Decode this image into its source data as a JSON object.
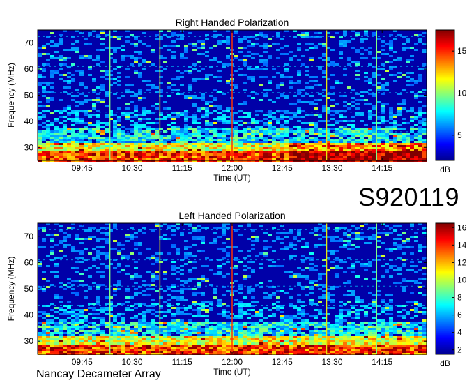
{
  "observation_id": "S920119",
  "instrument": "Nancay Decameter Array",
  "colors": {
    "jet_low": "#00008f",
    "jet_high": "#800000",
    "marker_yellow": "#e6e60a",
    "marker_green": "#7fff7f",
    "marker_red": "#ff3300"
  },
  "chart_data": [
    {
      "type": "heatmap",
      "title": "Right Handed Polarization",
      "xlabel": "Time (UT)",
      "ylabel": "Frequency (MHz)",
      "xticks": [
        "09:45",
        "10:30",
        "11:15",
        "12:00",
        "12:45",
        "13:30",
        "14:15"
      ],
      "xlim": [
        "09:05",
        "14:55"
      ],
      "yticks": [
        30,
        40,
        50,
        60,
        70
      ],
      "ylim": [
        25,
        75
      ],
      "colorbar": {
        "label": "dB",
        "ticks": [
          5,
          10,
          15
        ],
        "range": [
          2,
          17.5
        ]
      },
      "markers": [
        {
          "time": "10:10",
          "color": "green"
        },
        {
          "time": "10:55",
          "color": "yellow"
        },
        {
          "time": "12:00",
          "color": "red"
        },
        {
          "time": "13:25",
          "color": "yellow"
        },
        {
          "time": "14:10",
          "color": "green"
        }
      ]
    },
    {
      "type": "heatmap",
      "title": "Left Handed Polarization",
      "xlabel": "Time (UT)",
      "ylabel": "Frequency (MHz)",
      "xticks": [
        "09:45",
        "10:30",
        "11:15",
        "12:00",
        "12:45",
        "13:30",
        "14:15"
      ],
      "xlim": [
        "09:05",
        "14:55"
      ],
      "yticks": [
        30,
        40,
        50,
        60,
        70
      ],
      "ylim": [
        25,
        75
      ],
      "colorbar": {
        "label": "dB",
        "ticks": [
          2,
          4,
          6,
          8,
          10,
          12,
          14,
          16
        ],
        "range": [
          1.5,
          16.5
        ]
      },
      "markers": [
        {
          "time": "10:10",
          "color": "green"
        },
        {
          "time": "10:55",
          "color": "yellow"
        },
        {
          "time": "12:00",
          "color": "red"
        },
        {
          "time": "13:25",
          "color": "yellow"
        },
        {
          "time": "14:10",
          "color": "green"
        }
      ]
    }
  ]
}
